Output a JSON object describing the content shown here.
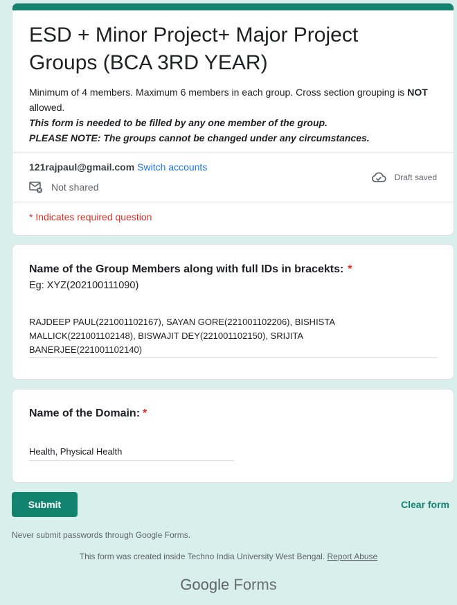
{
  "form": {
    "title": "ESD + Minor Project+ Major Project Groups (BCA 3RD YEAR)",
    "description": {
      "line1_prefix": "Minimum of 4 members. Maximum 6 members in each group. Cross section grouping is",
      "line1_bold": "NOT",
      "line1_suffix": "allowed.",
      "line2": "This form is needed to be filled by any one member of the group.",
      "line3": "PLEASE NOTE: The groups cannot be changed under any circumstances."
    },
    "account": {
      "email": "121rajpaul@gmail.com",
      "switch_label": "Switch accounts",
      "shared_status": "Not shared",
      "draft_status": "Draft saved"
    },
    "required_note": "* Indicates required question"
  },
  "questions": [
    {
      "title": "Name of the Group Members along with full IDs in bracekts:",
      "required_mark": "*",
      "subtitle": "Eg: XYZ(202100111090)",
      "answer": "RAJDEEP PAUL(221001102167), SAYAN GORE(221001102206), BISHISTA MALLICK(221001102148), BISWAJIT DEY(221001102150), SRIJITA BANERJEE(221001102140)"
    },
    {
      "title": "Name of the Domain:",
      "required_mark": "*",
      "answer": "Health, Physical  Health"
    }
  ],
  "actions": {
    "submit_label": "Submit",
    "clear_label": "Clear form"
  },
  "footer": {
    "warning": "Never submit passwords through Google Forms.",
    "created_text": "This form was created inside Techno India University West Bengal.",
    "report_label": "Report Abuse",
    "logo_google": "Google",
    "logo_forms": "Forms"
  },
  "colors": {
    "accent": "#12836f",
    "background": "#d9efec",
    "required": "#d93025",
    "link": "#1a73e8"
  },
  "icons": {
    "shared": "mail-not-shared-icon",
    "draft": "cloud-check-icon"
  }
}
